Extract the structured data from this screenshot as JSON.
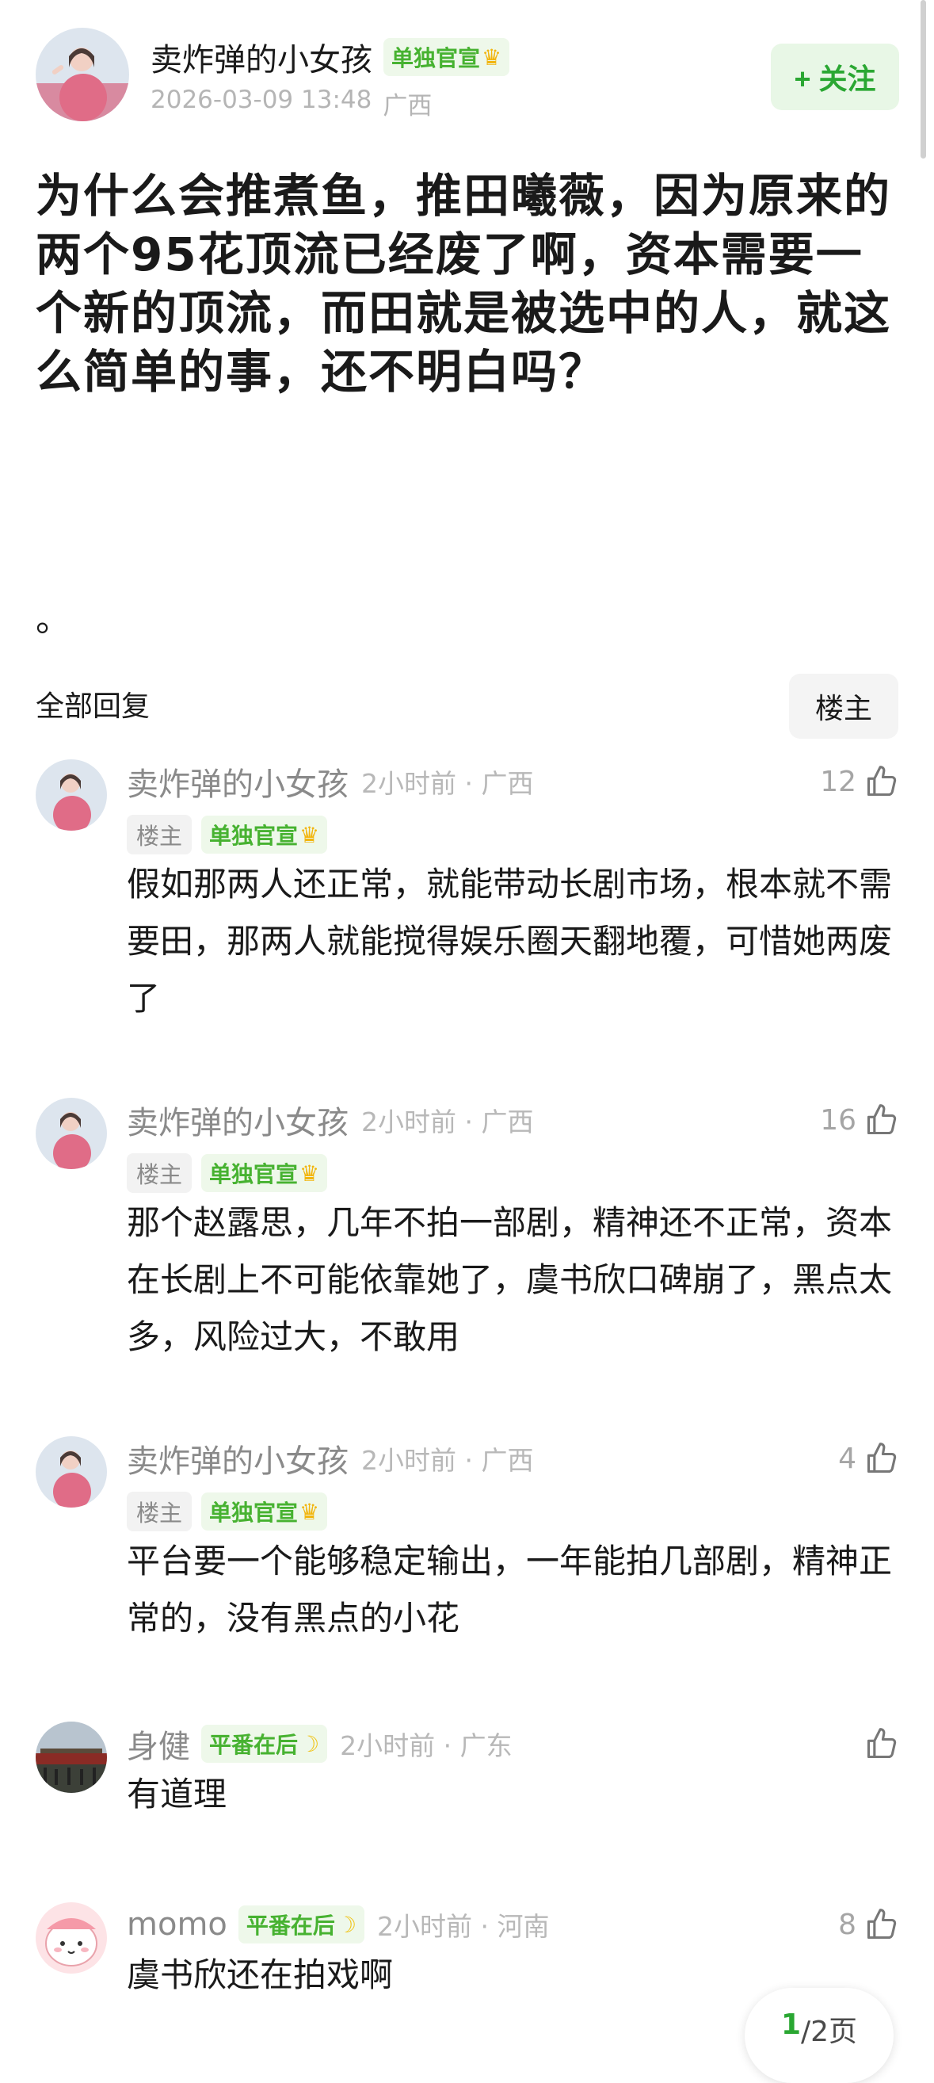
{
  "post": {
    "author": "卖炸弹的小女孩",
    "badge": "单独官宣",
    "datetime": "2026-03-09 13:48",
    "location": "广西",
    "follow_label": "+ 关注",
    "content": "为什么会推煮鱼，推田曦薇，因为原来的两个95花顶流已经废了啊，资本需要一个新的顶流，而田就是被选中的人，就这么简单的事，还不明白吗？",
    "trailing": "。"
  },
  "replies_header": {
    "title": "全部回复",
    "op_filter": "楼主"
  },
  "comments": [
    {
      "name": "卖炸弹的小女孩",
      "meta": "2小时前 · 广西",
      "op_tag": "楼主",
      "badge": "单独官宣",
      "likes": "12",
      "text": "假如那两人还正常，就能带动长剧市场，根本就不需要田，那两人就能搅得娱乐圈天翻地覆，可惜她两废了"
    },
    {
      "name": "卖炸弹的小女孩",
      "meta": "2小时前 · 广西",
      "op_tag": "楼主",
      "badge": "单独官宣",
      "likes": "16",
      "text": "那个赵露思，几年不拍一部剧，精神还不正常，资本在长剧上不可能依靠她了，虞书欣口碑崩了，黑点太多，风险过大，不敢用"
    },
    {
      "name": "卖炸弹的小女孩",
      "meta": "2小时前 · 广西",
      "op_tag": "楼主",
      "badge": "单独官宣",
      "likes": "4",
      "text": "平台要一个能够稳定输出，一年能拍几部剧，精神正常的，没有黑点的小花"
    },
    {
      "name": "身健",
      "meta": "2小时前 · 广东",
      "badge": "平番在后",
      "likes": "",
      "text": "有道理"
    },
    {
      "name": "momo",
      "meta": "2小时前 · 河南",
      "badge": "平番在后",
      "likes": "8",
      "text": "虞书欣还在拍戏啊"
    }
  ],
  "pager": {
    "current": "1",
    "total": "/2页"
  },
  "icons": {
    "crown": "crown-icon",
    "moon": "moon-icon",
    "thumb": "thumbs-up-icon"
  },
  "colors": {
    "accent_green": "#2aa732",
    "badge_green": "#47b231",
    "badge_bg": "#eef8ea",
    "muted": "#b8b8b8"
  }
}
